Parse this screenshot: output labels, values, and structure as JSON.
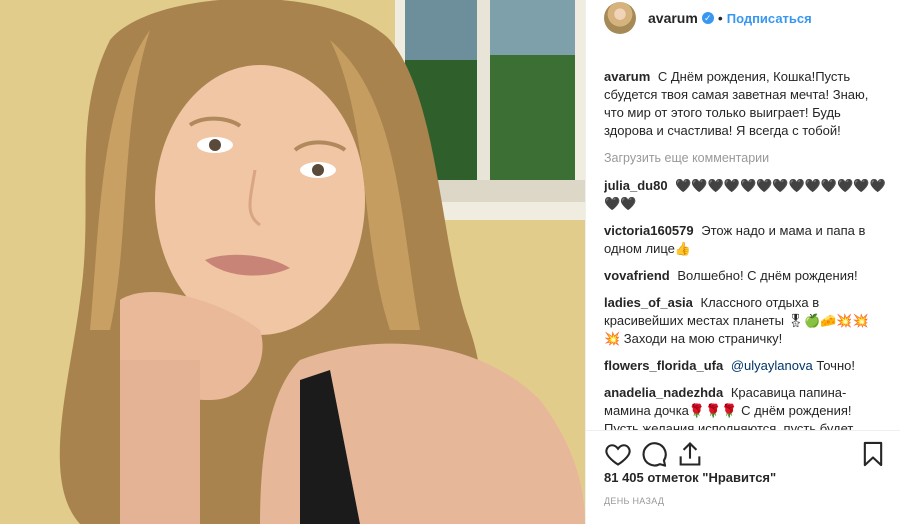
{
  "header": {
    "username": "avarum",
    "follow_label": "Подписаться",
    "separator": "•"
  },
  "caption": {
    "username": "avarum",
    "text": "С Днём рождения, Кошка!Пусть сбудется твоя самая заветная мечта! Знаю, что мир от этого только выиграет! Будь здорова и счастлива! Я всегда с тобой!"
  },
  "load_more_label": "Загрузить еще комментарии",
  "comments": [
    {
      "user": "julia_du80",
      "text": "🖤🖤🖤🖤🖤🖤🖤🖤🖤🖤🖤🖤🖤🖤🖤"
    },
    {
      "user": "victoria160579",
      "text": "Этож надо и мама и папа в одном лице👍"
    },
    {
      "user": "vovafriend",
      "text": "Волшебно! С днём рождения!"
    },
    {
      "user": "ladies_of_asia",
      "text": "Классного отдыха в красивейших местах планеты 🎖🍏🧀💥💥 💥 Заходи на мою страничку!"
    },
    {
      "user": "flowers_florida_ufa",
      "mention": "@ulyaylanova",
      "text": "Точно!"
    },
    {
      "user": "anadelia_nadezhda",
      "text": "Красавица папина-мамина дочка🌹🌹🌹 С днём рождения! Пусть желания исполняются, пусть будет"
    }
  ],
  "likes": "81 405 отметок \"Нравится\"",
  "timestamp": "ДЕНЬ НАЗАД",
  "icons": [
    "heart-icon",
    "comment-icon",
    "share-icon",
    "bookmark-icon",
    "verified-icon"
  ],
  "colors": {
    "link": "#3897f0",
    "text": "#262626",
    "muted": "#999999"
  }
}
